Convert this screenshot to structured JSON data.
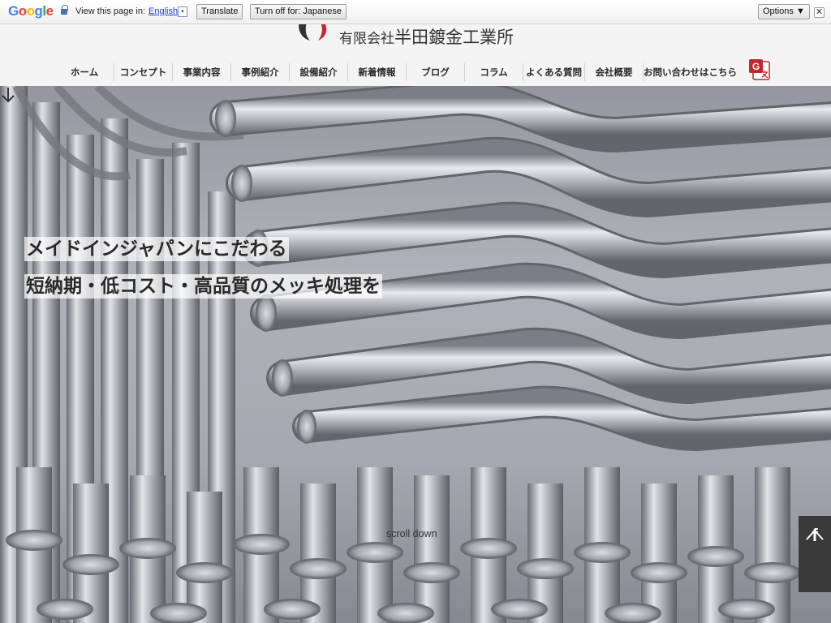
{
  "translate_bar": {
    "logo": "Google",
    "view_text": "View this page in:",
    "language": "English",
    "language_arrow": "▾",
    "translate_label": "Translate",
    "turn_off_label": "Turn off for: Japanese",
    "options_label": "Options ▼",
    "close_label": "✕"
  },
  "header": {
    "company_prefix": "有限会社",
    "company_name": "半田鍍金工業所"
  },
  "nav": {
    "items": [
      "ホーム",
      "コンセプト",
      "事業内容",
      "事例紹介",
      "設備紹介",
      "新着情報",
      "ブログ",
      "コラム",
      "よくある質問",
      "会社概要",
      "お問い合わせはこちら"
    ]
  },
  "hero": {
    "tagline_line1": "メイドインジャパンにこだわる",
    "tagline_line2": "短納期・低コスト・高品質のメッキ処理を",
    "scroll_label": "scroll down"
  },
  "side": {
    "facebook_label": "f"
  },
  "colors": {
    "logo_red": "#c0282d",
    "logo_dark": "#333333",
    "header_bg": "#f4f4f4",
    "side_panel_bg": "#3a3a3a",
    "link_blue": "#1a3fd6"
  }
}
